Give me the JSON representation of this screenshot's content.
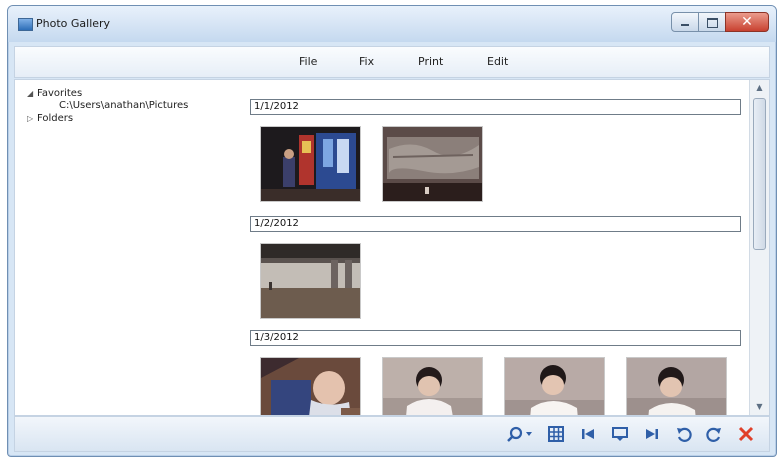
{
  "window": {
    "title": "Photo Gallery",
    "controls": {
      "minimize_icon": "minimize-icon",
      "maximize_icon": "maximize-icon",
      "close_glyph": "✕"
    }
  },
  "menu": {
    "items": [
      {
        "label": "File"
      },
      {
        "label": "Fix"
      },
      {
        "label": "Print"
      },
      {
        "label": "Edit"
      }
    ]
  },
  "tree": {
    "favorites": {
      "label": "Favorites",
      "expanded_glyph": "◢"
    },
    "path": {
      "label": "C:\\Users\\anathan\\Pictures"
    },
    "folders": {
      "label": "Folders",
      "collapsed_glyph": "▷"
    }
  },
  "gallery": {
    "groups": [
      {
        "date": "1/1/2012",
        "photo_count": 2
      },
      {
        "date": "1/2/2012",
        "photo_count": 1
      },
      {
        "date": "1/3/2012",
        "photo_count": 4
      }
    ]
  },
  "scrollbar": {
    "up_glyph": "▲",
    "down_glyph": "▼"
  },
  "toolbar": {
    "buttons": [
      {
        "name": "zoom-icon",
        "glyph": "⚲▾"
      },
      {
        "name": "grid-view-icon",
        "glyph": "▦"
      },
      {
        "name": "previous-icon",
        "glyph": "⏮"
      },
      {
        "name": "slideshow-icon",
        "glyph": "▭"
      },
      {
        "name": "next-icon",
        "glyph": "⏭"
      },
      {
        "name": "rotate-left-icon",
        "glyph": "↺"
      },
      {
        "name": "rotate-right-icon",
        "glyph": "↻"
      },
      {
        "name": "delete-icon",
        "glyph": "✕"
      }
    ]
  },
  "colors": {
    "accent": "#2f5fa8",
    "delete": "#e0402a",
    "frame": "#d7e6f5"
  }
}
